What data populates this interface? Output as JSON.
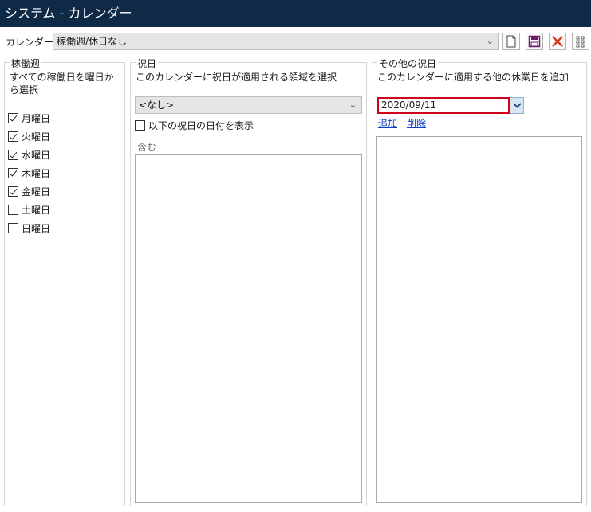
{
  "window": {
    "title": "システム - カレンダー"
  },
  "calendar": {
    "label": "カレンダー",
    "selected": "稼働週/休日なし",
    "toolbar": {
      "new_icon": "new-document-icon",
      "save_icon": "save-icon",
      "delete_icon": "delete-x-icon",
      "more_icon": "grid-dots-icon"
    }
  },
  "working_week": {
    "legend": "稼働週",
    "description_line1": "すべての稼働日を曜日か",
    "description_line2": "ら選択",
    "days": [
      {
        "label": "月曜日",
        "checked": true
      },
      {
        "label": "火曜日",
        "checked": true
      },
      {
        "label": "水曜日",
        "checked": true
      },
      {
        "label": "木曜日",
        "checked": true
      },
      {
        "label": "金曜日",
        "checked": true
      },
      {
        "label": "土曜日",
        "checked": false
      },
      {
        "label": "日曜日",
        "checked": false
      }
    ]
  },
  "holidays": {
    "legend": "祝日",
    "description": "このカレンダーに祝日が適用される領域を選択",
    "region_selected": "<なし>",
    "show_dates_label": "以下の祝日の日付を表示",
    "show_dates_checked": false,
    "include_label": "含む"
  },
  "other_holidays": {
    "legend": "その他の祝日",
    "description": "このカレンダーに適用する他の休業日を追加",
    "date_value": "2020/09/11",
    "add_link": "追加",
    "remove_link": "削除"
  },
  "colors": {
    "titlebar": "#0e2a47",
    "focus_border": "#d0021b",
    "link": "#0f40c8"
  }
}
